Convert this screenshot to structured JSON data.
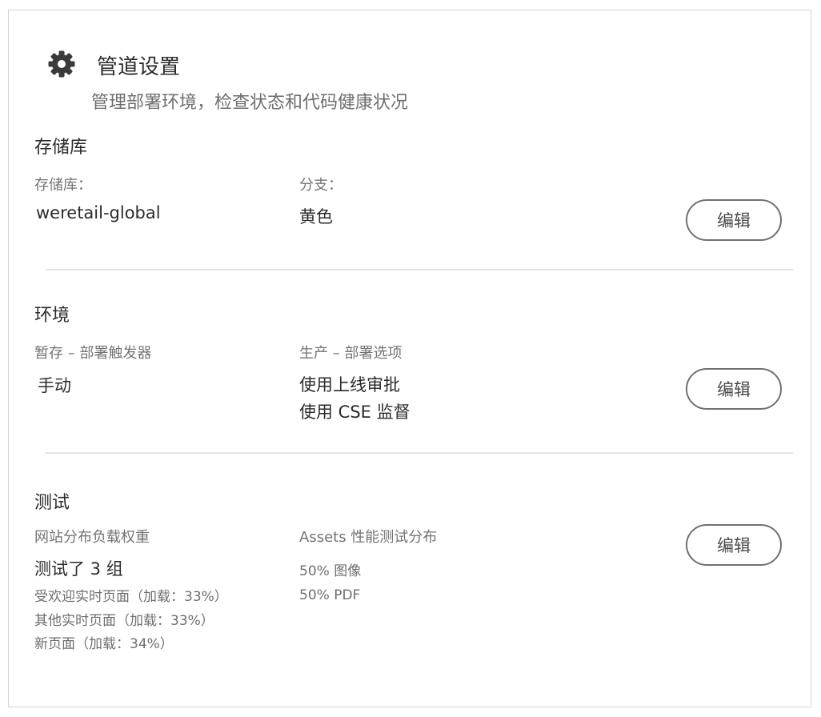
{
  "header": {
    "title": "管道设置",
    "subtitle": "管理部署环境，检查状态和代码健康状况",
    "icon": "gear-icon"
  },
  "repository": {
    "heading": "存储库",
    "repo_label": "存储库：",
    "repo_value": "weretail-global",
    "branch_label": "分支：",
    "branch_value": "黄色",
    "edit_label": "编辑"
  },
  "environments": {
    "heading": "环境",
    "stage_label": "暂存 – 部署触发器",
    "stage_value": "手动",
    "prod_label": "生产 – 部署选项",
    "prod_values": [
      "使用上线审批",
      "使用 CSE 监督"
    ],
    "edit_label": "编辑"
  },
  "testing": {
    "heading": "测试",
    "site_label": "网站分布负载权重",
    "site_value": "测试了 3 组",
    "site_groups": [
      "受欢迎实时页面（加载：33%）",
      "其他实时页面（加载：33%）",
      "新页面（加载：34%）"
    ],
    "assets_label": "Assets 性能测试分布",
    "assets_values": [
      "50% 图像",
      "50% PDF"
    ],
    "edit_label": "编辑"
  },
  "colors": {
    "border": "#d5d5d5",
    "divider": "#e6e6e6",
    "text_primary": "#2b2b2b",
    "text_secondary": "#6e6e6e",
    "button_border": "#707070"
  }
}
